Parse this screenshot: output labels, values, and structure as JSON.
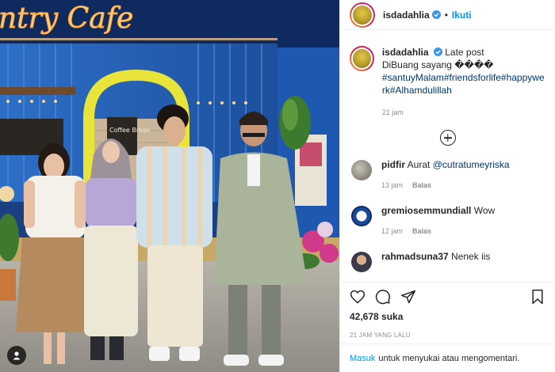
{
  "photo": {
    "sign_text": "ntry Cafe",
    "menu_board_text": "Coffee Break"
  },
  "post": {
    "username": "isdadahlia",
    "separator": "•",
    "follow_label": "Ikuti",
    "caption_username": "isdadahlia",
    "caption_line1": "Late post",
    "caption_line2": "DiBuang sayang ����",
    "hashtags": "#santuyMalam#friendsforlife#happywerk#Alhamdulillah",
    "caption_time": "21 jam"
  },
  "comments": [
    {
      "username": "pidfir",
      "text_prefix": "Aurat ",
      "mention": "@cutratumeyriska",
      "text": "",
      "time": "13 jam",
      "reply": "Balas"
    },
    {
      "username": "gremiosemmundiall",
      "text_prefix": "",
      "mention": "",
      "text": "Wow",
      "time": "12 jam",
      "reply": "Balas"
    },
    {
      "username": "rahmadsuna37",
      "text_prefix": "",
      "mention": "",
      "text": "Nenek iis",
      "time": "",
      "reply": ""
    }
  ],
  "actions": {
    "likes": "42,678 suka",
    "post_time": "21 JAM YANG LALU"
  },
  "login": {
    "link": "Masuk",
    "rest": "untuk menyukai atau mengomentari."
  },
  "colors": {
    "accent": "#0095f6",
    "hashtag": "#00376b",
    "muted": "#8e8e8e",
    "sign_glow": "#ffb64a"
  },
  "icons": [
    "verified-icon",
    "plus-circle-icon",
    "heart-icon",
    "comment-icon",
    "share-icon",
    "bookmark-icon",
    "user-tag-icon"
  ]
}
